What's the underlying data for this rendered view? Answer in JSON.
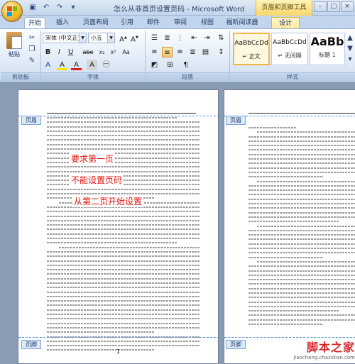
{
  "window": {
    "title": "怎么从非首页设置页码 - Microsoft Word",
    "context_group": "页眉和页脚工具"
  },
  "quick_access": [
    "save-icon",
    "undo-icon",
    "redo-icon",
    "customize-icon"
  ],
  "window_buttons": {
    "minimize": "–",
    "maximize": "□",
    "close": "×"
  },
  "tabs": [
    "开始",
    "插入",
    "页面布局",
    "引用",
    "邮件",
    "审阅",
    "视图",
    "福昕阅读器",
    "设计"
  ],
  "ribbon": {
    "clipboard": {
      "paste_label": "粘贴",
      "group_label": "剪贴板"
    },
    "font": {
      "font_name": "宋体 (中文正文)",
      "font_size": "小五",
      "group_label": "字体",
      "buttons": [
        "B",
        "I",
        "U",
        "abe",
        "x₂",
        "x²",
        "Aa",
        "A",
        "A",
        "A",
        "A"
      ]
    },
    "paragraph": {
      "group_label": "段落"
    },
    "styles": {
      "group_label": "样式",
      "items": [
        {
          "sample": "AaBbCcDd",
          "name": "↵ 正文"
        },
        {
          "sample": "AaBbCcDd",
          "name": "↵ 无间隔"
        },
        {
          "sample": "AaBb",
          "name": "标题 1"
        }
      ]
    }
  },
  "document": {
    "header_tag": "页眉",
    "footer_tag": "页脚",
    "left_page_number": "1",
    "annotations": [
      "要求第一页",
      "不能设置页码",
      "从第二页开始设置"
    ]
  },
  "watermark": {
    "main": "脚本之家",
    "sub": "jiaocheng.chazidian.com"
  }
}
